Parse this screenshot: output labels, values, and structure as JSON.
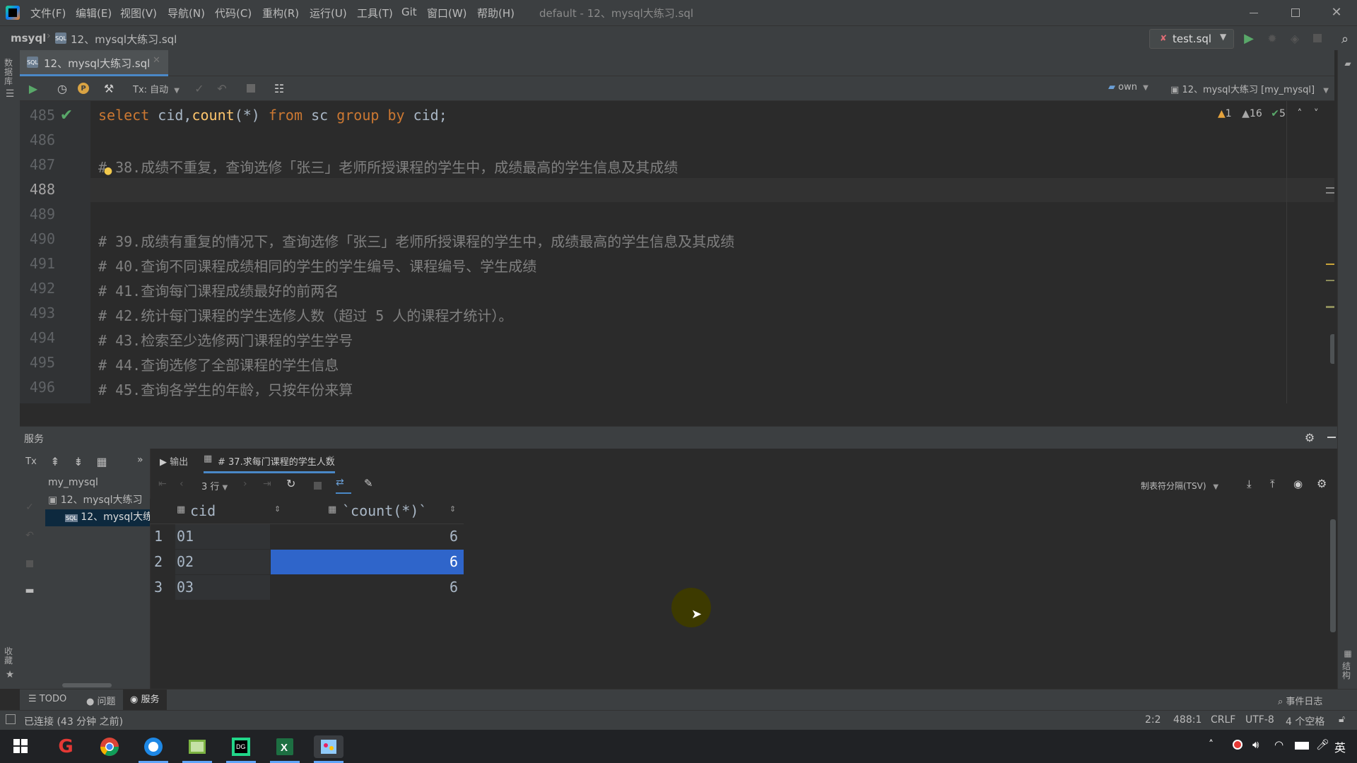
{
  "window": {
    "title": "default - 12、mysql大练习.sql",
    "menu": [
      "文件(F)",
      "编辑(E)",
      "视图(V)",
      "导航(N)",
      "代码(C)",
      "重构(R)",
      "运行(U)",
      "工具(T)",
      "Git",
      "窗口(W)",
      "帮助(H)"
    ]
  },
  "navbar": {
    "project": "msyql",
    "file": "12、mysql大练习.sql",
    "run_config": "test.sql"
  },
  "editor_tab": {
    "label": "12、mysql大练习.sql"
  },
  "toolbar": {
    "tx_mode": "Tx: 自动",
    "schema_own": "own",
    "datasource": "12、mysql大练习 [my_mysql]"
  },
  "inspections": {
    "warn1": "1",
    "warn2": "16",
    "ok": "5"
  },
  "editor": {
    "lines": [
      {
        "n": "485"
      },
      {
        "n": "486"
      },
      {
        "n": "487",
        "text": "38.成绩不重复，查询选修「张三」老师所授课程的学生中，成绩最高的学生信息及其成绩"
      },
      {
        "n": "488"
      },
      {
        "n": "489"
      },
      {
        "n": "490",
        "text": "# 39.成绩有重复的情况下，查询选修「张三」老师所授课程的学生中，成绩最高的学生信息及其成绩"
      },
      {
        "n": "491",
        "text": "# 40.查询不同课程成绩相同的学生的学生编号、课程编号、学生成绩"
      },
      {
        "n": "492",
        "text": "# 41.查询每门课程成绩最好的前两名"
      },
      {
        "n": "493",
        "text": "# 42.统计每门课程的学生选修人数（超过 5 人的课程才统计）。"
      },
      {
        "n": "494",
        "text": "# 43.检索至少选修两门课程的学生学号"
      },
      {
        "n": "495",
        "text": "# 44.查询选修了全部课程的学生信息"
      },
      {
        "n": "496",
        "text": "# 45.查询各学生的年龄，只按年份来算"
      }
    ],
    "sql_tokens": {
      "select": "select",
      "cols": " cid,",
      "count": "count",
      "star": "(*)",
      "from": " from",
      "table": " sc",
      "group": " group",
      "by": " by",
      "tail": " cid;"
    },
    "line487_prefix": "#"
  },
  "services": {
    "title": "服务",
    "tree": {
      "root": "my_mysql",
      "child1": "12、mysql大练习",
      "child2": "12、mysql大练"
    },
    "tabs": {
      "output": "输出",
      "result": "# 37.求每门课程的学生人数"
    },
    "rows_label": "3 行",
    "export_format": "制表符分隔(TSV)",
    "columns": [
      "cid",
      "`count(*)`"
    ],
    "rows": [
      {
        "idx": "1",
        "cid": "01",
        "count": "6"
      },
      {
        "idx": "2",
        "cid": "02",
        "count": "6"
      },
      {
        "idx": "3",
        "cid": "03",
        "count": "6"
      }
    ]
  },
  "tool_tabs": {
    "todo": "TODO",
    "problems": "问题",
    "services": "服务",
    "event_log": "事件日志"
  },
  "status": {
    "connection": "已连接 (43 分钟 之前)",
    "selection": "2:2",
    "caret": "488:1",
    "line_sep": "CRLF",
    "encoding": "UTF-8",
    "indent": "4 个空格"
  },
  "side_labels": {
    "database": "数据库",
    "favorites": "收藏",
    "structure": "结构"
  },
  "tray": {
    "ime": "英"
  }
}
